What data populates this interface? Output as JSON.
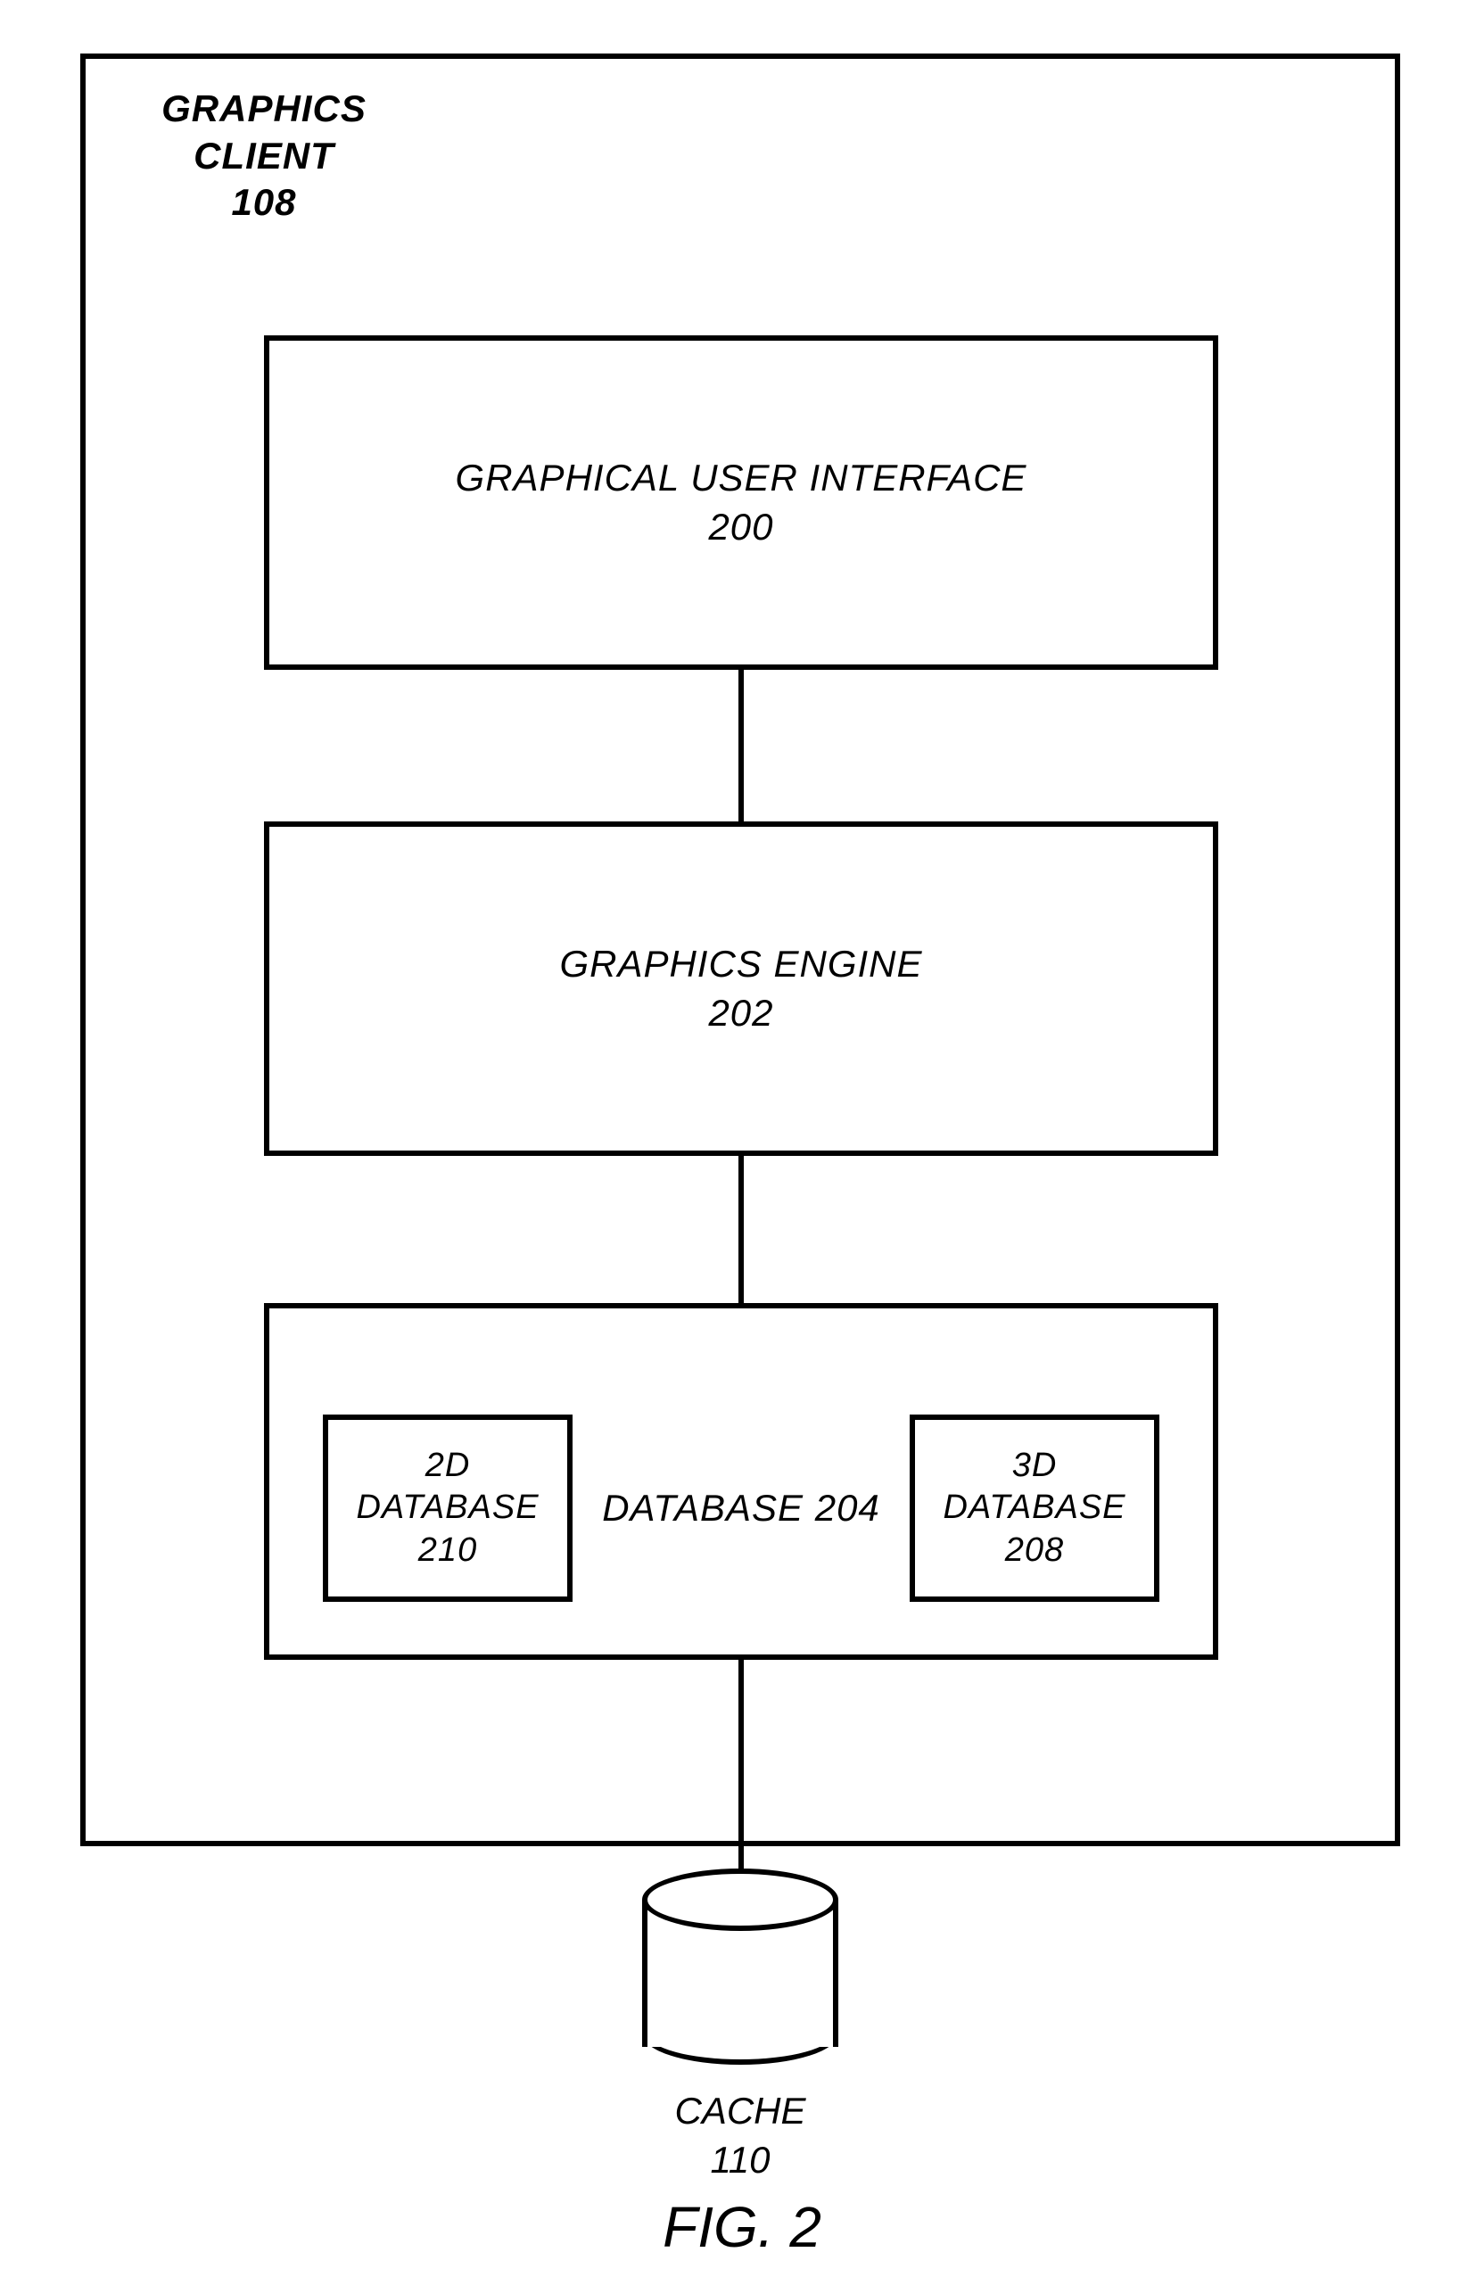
{
  "diagram": {
    "container": {
      "title": "GRAPHICS CLIENT",
      "ref": "108"
    },
    "gui": {
      "title": "GRAPHICAL USER INTERFACE",
      "ref": "200"
    },
    "engine": {
      "title": "GRAPHICS ENGINE",
      "ref": "202"
    },
    "database": {
      "title": "DATABASE 204"
    },
    "db2d": {
      "title": "2D DATABASE",
      "ref": "210"
    },
    "db3d": {
      "title": "3D DATABASE",
      "ref": "208"
    },
    "cache": {
      "title": "CACHE",
      "ref": "110"
    },
    "figure": "FIG. 2"
  }
}
